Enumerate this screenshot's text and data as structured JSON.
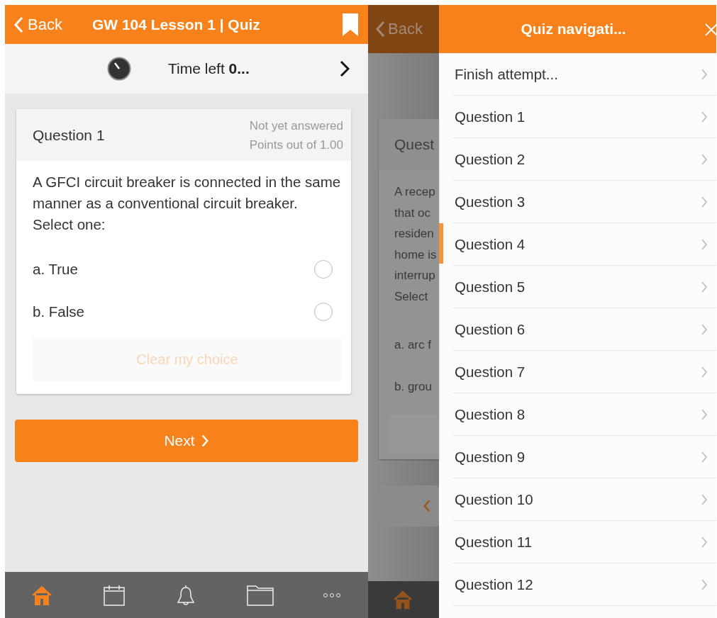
{
  "left": {
    "header": {
      "back": "Back",
      "title": "GW 104 Lesson 1 | Quiz"
    },
    "timer": {
      "text": "Time left **0...**"
    },
    "question": {
      "title": "Question 1",
      "status": "Not yet answered",
      "points": "Points out of 1.00",
      "text": "A GFCI circuit breaker is connected in the same manner as a conventional circuit breaker.",
      "prompt": "Select one:",
      "options": [
        {
          "label": "a. True",
          "selected": false
        },
        {
          "label": "b. False",
          "selected": false
        }
      ],
      "clear": "Clear my choice"
    },
    "next": "Next",
    "nav": [
      {
        "kind": "home",
        "selected": true
      },
      {
        "kind": "calendar",
        "selected": false
      },
      {
        "kind": "bell",
        "selected": false
      },
      {
        "kind": "folder",
        "selected": false
      },
      {
        "kind": "more",
        "selected": false
      }
    ]
  },
  "right": {
    "behind": {
      "back": "Back",
      "title": "Quest",
      "lines": [
        "A recep",
        "that oc",
        "residen",
        "home is",
        "interrup",
        "Select"
      ],
      "options": [
        "a. arc f",
        "b. grou"
      ]
    },
    "drawer": {
      "title": "Quiz navigati...",
      "items": [
        {
          "label": "Finish attempt..."
        },
        {
          "label": "Question 1"
        },
        {
          "label": "Question 2"
        },
        {
          "label": "Question 3"
        },
        {
          "label": "Question 4"
        },
        {
          "label": "Question 5"
        },
        {
          "label": "Question 6"
        },
        {
          "label": "Question 7"
        },
        {
          "label": "Question 8"
        },
        {
          "label": "Question 9"
        },
        {
          "label": "Question 10"
        },
        {
          "label": "Question 11"
        },
        {
          "label": "Question 12"
        }
      ]
    }
  }
}
